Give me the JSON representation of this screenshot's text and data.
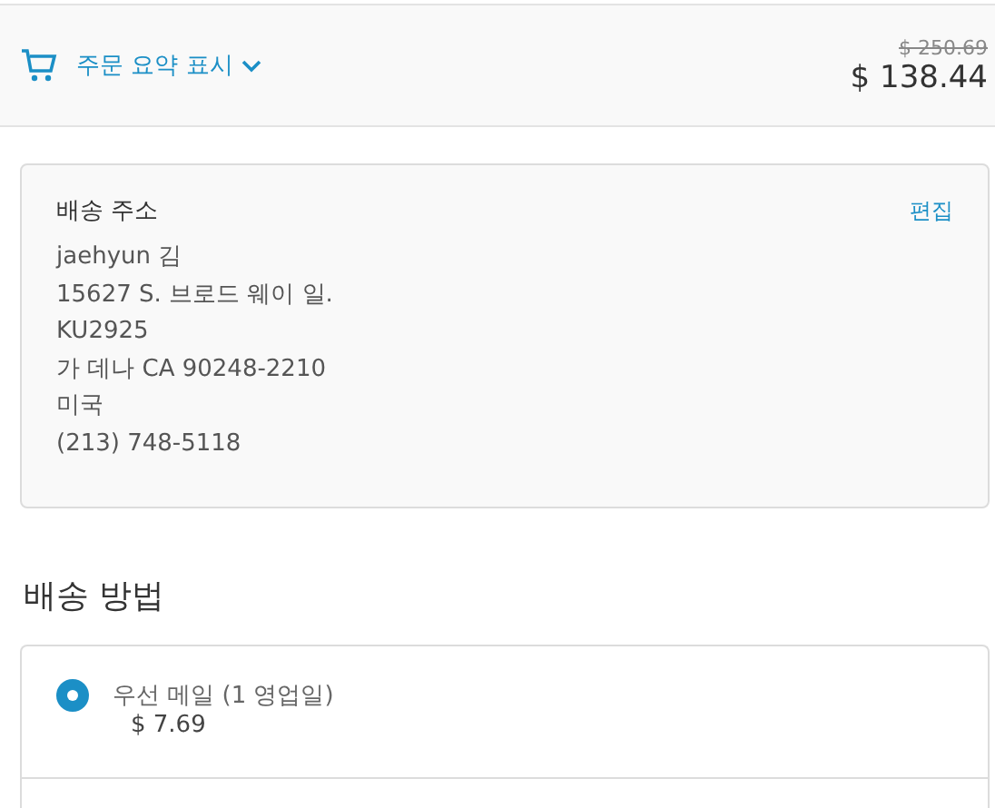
{
  "summary_bar": {
    "toggle_label": "주문 요약 표시",
    "original_price": "$ 250.69",
    "total": "$ 138.44"
  },
  "shipping_address": {
    "title": "배송 주소",
    "edit_link": "편집",
    "lines": [
      "jaehyun 김",
      "15627 S. 브로드 웨이 일.",
      "KU2925",
      "가 데나 CA 90248-2210",
      "미국",
      "(213) 748-5118"
    ]
  },
  "shipping_method": {
    "title": "배송 방법",
    "options": [
      {
        "label": "우선 메일 (1 영업일)",
        "price": "$ 7.69",
        "selected": true
      }
    ]
  }
}
